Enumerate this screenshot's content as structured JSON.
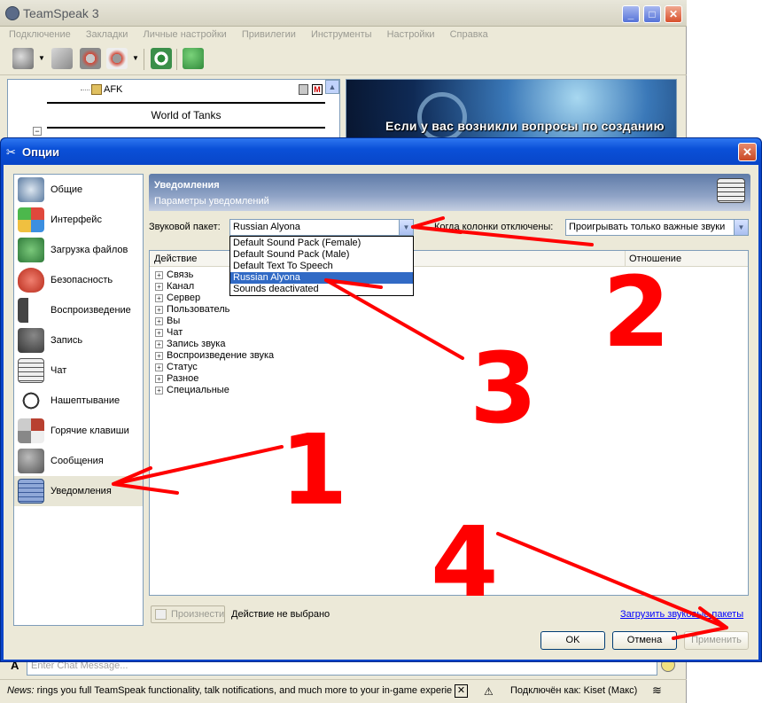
{
  "app": {
    "title": "TeamSpeak 3",
    "menu": [
      "Подключение",
      "Закладки",
      "Личные настройки",
      "Привилегии",
      "Инструменты",
      "Настройки",
      "Справка"
    ],
    "tree": {
      "afk_channel": "AFK",
      "spacer_channel": "World of Tanks"
    },
    "banner_text": "Если у вас возникли вопросы по созданию",
    "chat_placeholder": "Enter Chat Message...",
    "news_label": "News:",
    "news_text": "rings you full TeamSpeak functionality, talk notifications, and much more to your in-game experie",
    "status_text": "Подключён как: Kiset (Макс)"
  },
  "dialog": {
    "title": "Опции",
    "sidebar": [
      {
        "label": "Общие",
        "icon": "general-icon"
      },
      {
        "label": "Интерфейс",
        "icon": "interface-icon"
      },
      {
        "label": "Загрузка файлов",
        "icon": "file-transfer-icon"
      },
      {
        "label": "Безопасность",
        "icon": "security-lock-icon"
      },
      {
        "label": "Воспроизведение",
        "icon": "speaker-icon"
      },
      {
        "label": "Запись",
        "icon": "microphone-icon"
      },
      {
        "label": "Чат",
        "icon": "chat-icon"
      },
      {
        "label": "Нашептывание",
        "icon": "headset-icon"
      },
      {
        "label": "Горячие клавиши",
        "icon": "hotkeys-icon"
      },
      {
        "label": "Сообщения",
        "icon": "messages-icon"
      },
      {
        "label": "Уведомления",
        "icon": "notifications-icon"
      }
    ],
    "active_section": "Уведомления",
    "header": {
      "title": "Уведомления",
      "subtitle": "Параметры уведомлений"
    },
    "sound_pack": {
      "label": "Звуковой пакет:",
      "value": "Russian Alyona",
      "options": [
        "Default Sound Pack (Female)",
        "Default Sound Pack (Male)",
        "Default Text To Speech",
        "Russian Alyona",
        "Sounds deactivated"
      ]
    },
    "speakers_off": {
      "label": "Когда колонки отключены:",
      "value": "Проигрывать только важные звуки"
    },
    "table": {
      "columns": [
        "Действие",
        "Отношение"
      ],
      "rows": [
        "Связь",
        "Канал",
        "Сервер",
        "Пользователь",
        "Вы",
        "Чат",
        "Запись звука",
        "Воспроизведение звука",
        "Статус",
        "Разное",
        "Специальные"
      ]
    },
    "speak_button": "Произнести",
    "no_action_text": "Действие не выбрано",
    "load_packs_link": "Загрузить звуковые пакеты",
    "buttons": {
      "ok": "OK",
      "cancel": "Отмена",
      "apply": "Применить"
    }
  },
  "annotations": {
    "color": "#ff0000",
    "labels": [
      "1",
      "2",
      "3",
      "4"
    ]
  }
}
